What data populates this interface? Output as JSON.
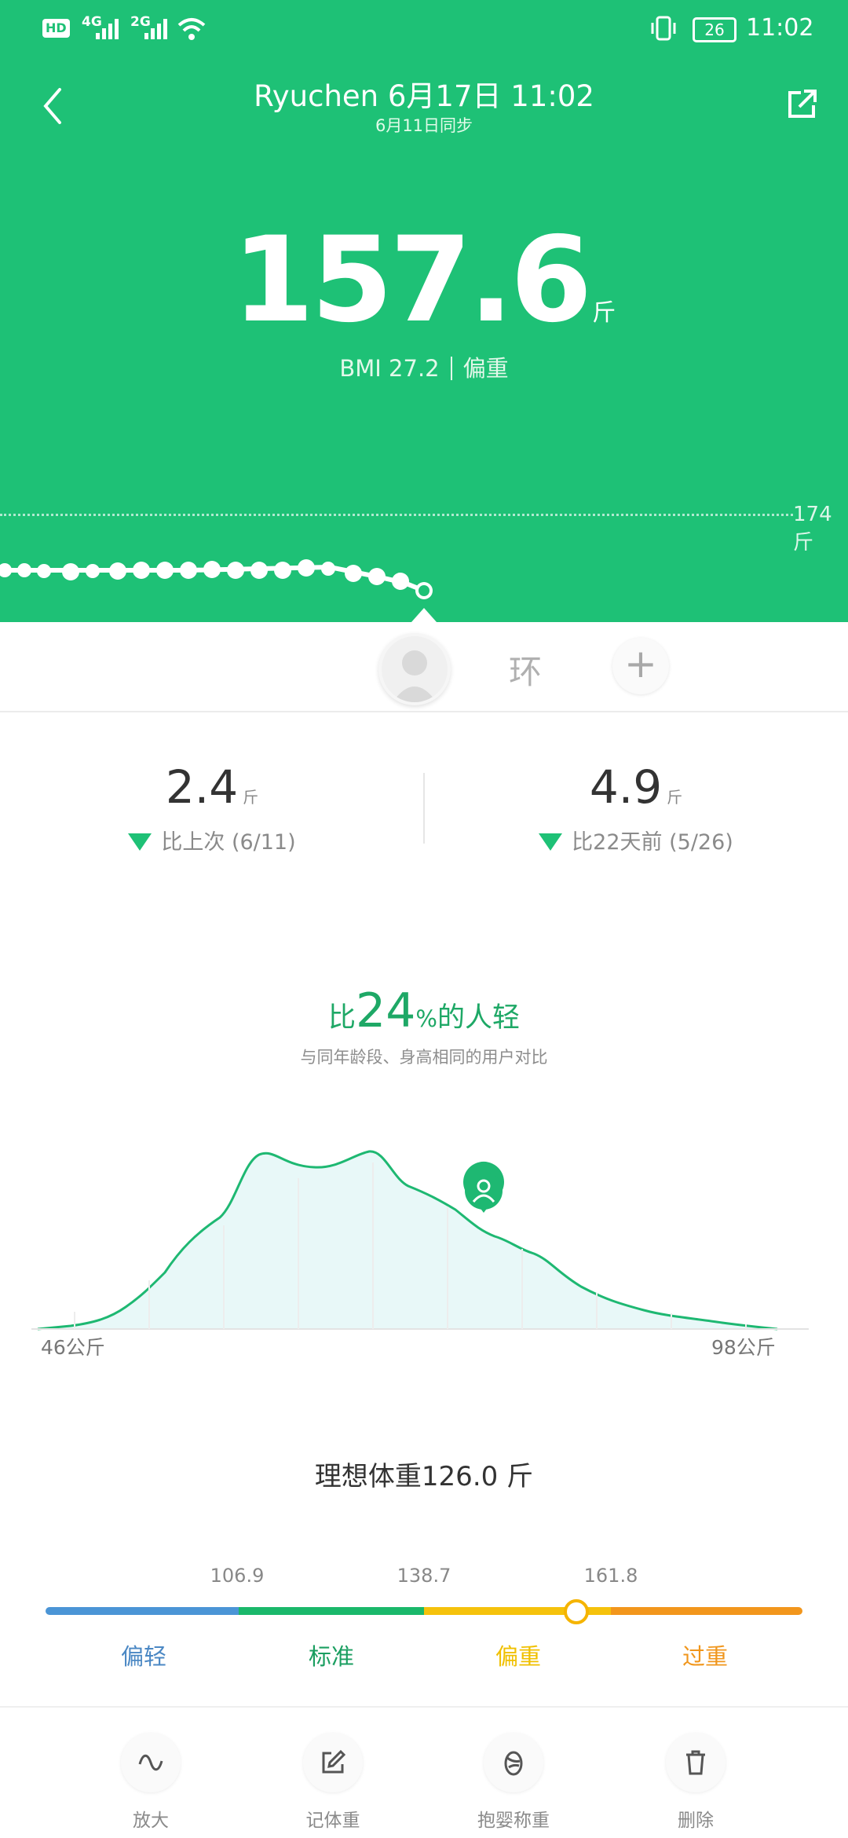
{
  "status_bar": {
    "network_left": "HD",
    "signal_1": "4G",
    "signal_2": "2G",
    "battery": "26",
    "time": "11:02"
  },
  "header": {
    "title": "Ryuchen 6月17日 11:02",
    "subtitle": "6月11日同步",
    "back_icon": "chevron-left-icon",
    "share_icon": "external-share-icon"
  },
  "weight": {
    "value": "157.6",
    "unit": "斤",
    "bmi_label": "BMI 27.2",
    "bmi_category": "偏重"
  },
  "trend": {
    "reference_label": "174斤"
  },
  "members": {
    "ring_label": "环",
    "add_label": "+"
  },
  "comparisons": [
    {
      "value": "2.4",
      "unit": "斤",
      "label": "比上次 (6/11)"
    },
    {
      "value": "4.9",
      "unit": "斤",
      "label": "比22天前 (5/26)"
    }
  ],
  "distribution": {
    "prefix": "比",
    "percent": "24",
    "percent_sign": "%",
    "suffix": "的人轻",
    "subtitle": "与同年龄段、身高相同的用户对比",
    "min_label": "46公斤",
    "max_label": "98公斤"
  },
  "chart_data": {
    "type": "area",
    "title": "比24%的人轻",
    "subtitle": "与同年龄段、身高相同的用户对比",
    "x_range_labels": [
      "46公斤",
      "98公斤"
    ],
    "marker_percentile": 24,
    "colors": {
      "line": "#1ec176",
      "fill": "#e8f8f8"
    }
  },
  "ideal_weight": {
    "label": "理想体重126.0 斤"
  },
  "bmi_bar": {
    "thresholds": [
      "106.9",
      "138.7",
      "161.8"
    ],
    "categories": [
      {
        "label": "偏轻",
        "color": "#4b95d6"
      },
      {
        "label": "标准",
        "color": "#1ab86b"
      },
      {
        "label": "偏重",
        "color": "#f5c20c"
      },
      {
        "label": "过重",
        "color": "#f2961c"
      }
    ],
    "current_value": "157.6"
  },
  "toolbar": [
    {
      "label": "放大",
      "icon": "wave-icon"
    },
    {
      "label": "记体重",
      "icon": "edit-icon"
    },
    {
      "label": "抱婴称重",
      "icon": "baby-scale-icon"
    },
    {
      "label": "删除",
      "icon": "trash-icon"
    }
  ]
}
